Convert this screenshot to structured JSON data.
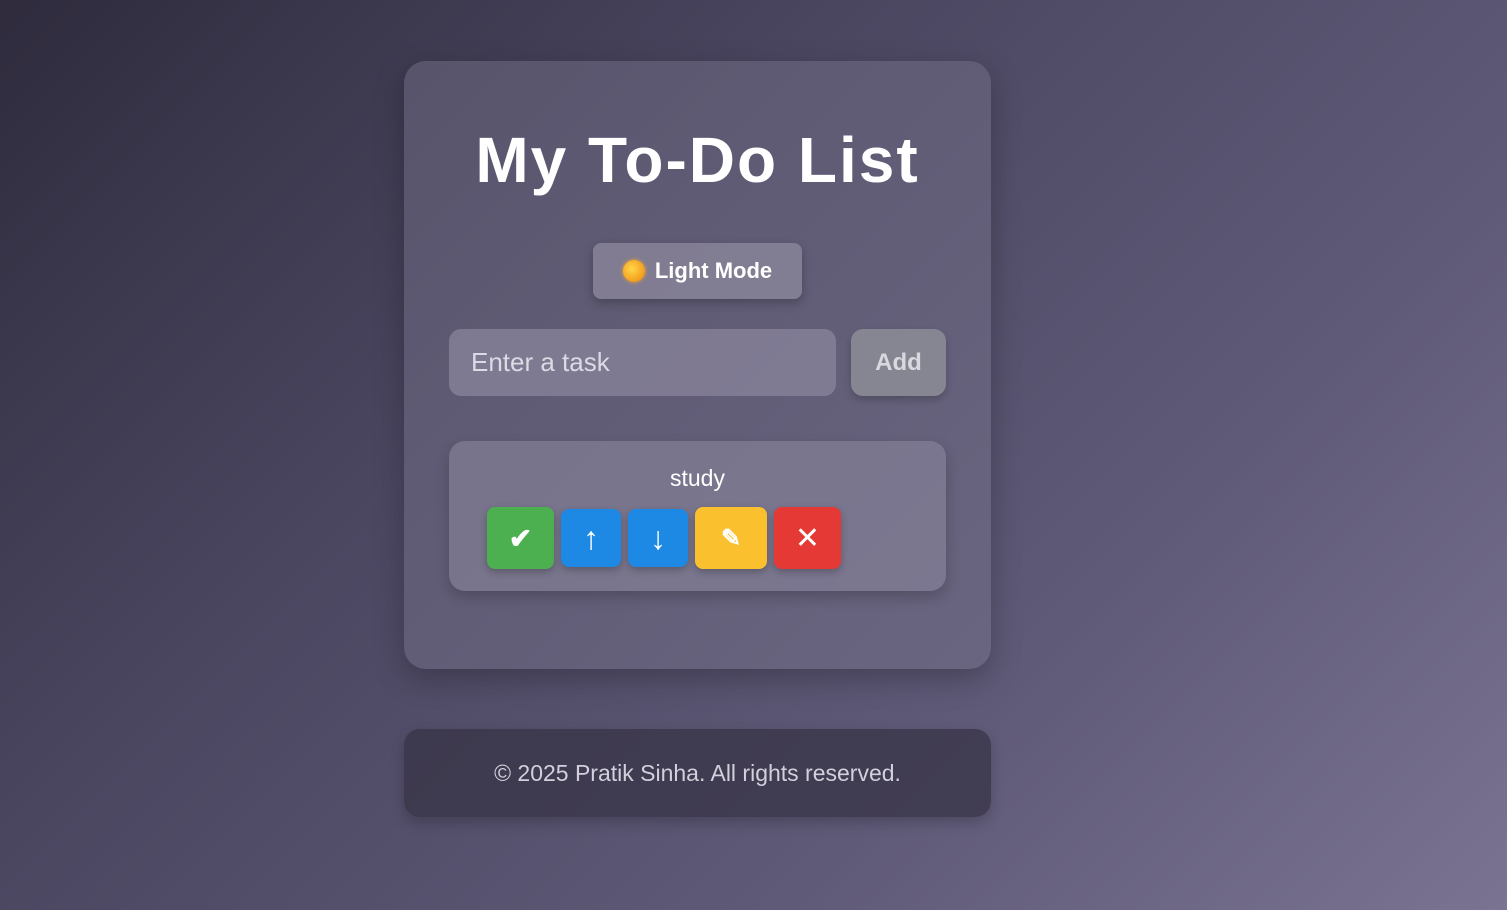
{
  "app": {
    "title": "My To-Do List"
  },
  "theme_toggle": {
    "label": "Light Mode",
    "icon": "sun-icon"
  },
  "task_input": {
    "placeholder": "Enter a task",
    "value": ""
  },
  "add_button": {
    "label": "Add"
  },
  "tasks": [
    {
      "text": "study",
      "actions": {
        "complete": "✔",
        "move_up": "↑",
        "move_down": "↓",
        "edit": "✎",
        "delete": "✕"
      }
    }
  ],
  "footer": {
    "text": "© 2025 Pratik Sinha. All rights reserved."
  },
  "colors": {
    "complete": "#4caf50",
    "move": "#1e88e5",
    "edit": "#fbc02d",
    "delete": "#e53935"
  }
}
